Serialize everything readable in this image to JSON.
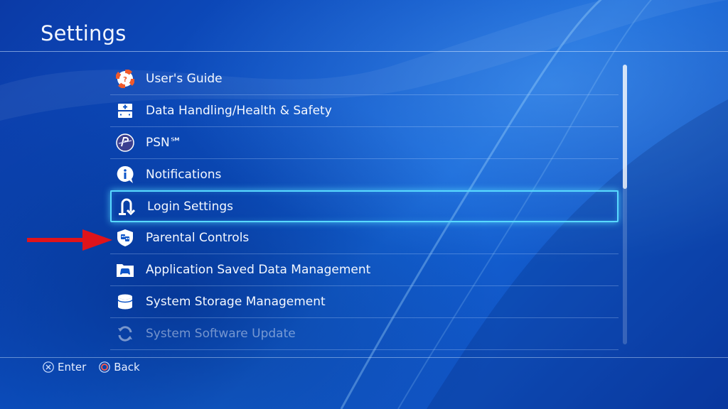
{
  "header": {
    "title": "Settings"
  },
  "menu": {
    "items": [
      {
        "label": "User's Guide",
        "icon": "lifebuoy-icon"
      },
      {
        "label": "Data Handling/Health & Safety",
        "icon": "first-aid-icon"
      },
      {
        "label": "PSN℠",
        "icon": "psn-icon"
      },
      {
        "label": "Notifications",
        "icon": "info-bubble-icon"
      },
      {
        "label": "Login Settings",
        "icon": "login-icon"
      },
      {
        "label": "Parental Controls",
        "icon": "parental-shield-icon"
      },
      {
        "label": "Application Saved Data Management",
        "icon": "gamepad-folder-icon"
      },
      {
        "label": "System Storage Management",
        "icon": "storage-cylinder-icon"
      },
      {
        "label": "System Software Update",
        "icon": "update-arrows-icon"
      }
    ],
    "selected_index": 4
  },
  "footer": {
    "enter_label": "Enter",
    "back_label": "Back"
  },
  "colors": {
    "background": "#0d55c9",
    "highlight_border": "#59d9ff",
    "annotation_arrow": "#e0141b",
    "lifebuoy": "#f05a2b",
    "back_button": "#ff5a4a"
  }
}
